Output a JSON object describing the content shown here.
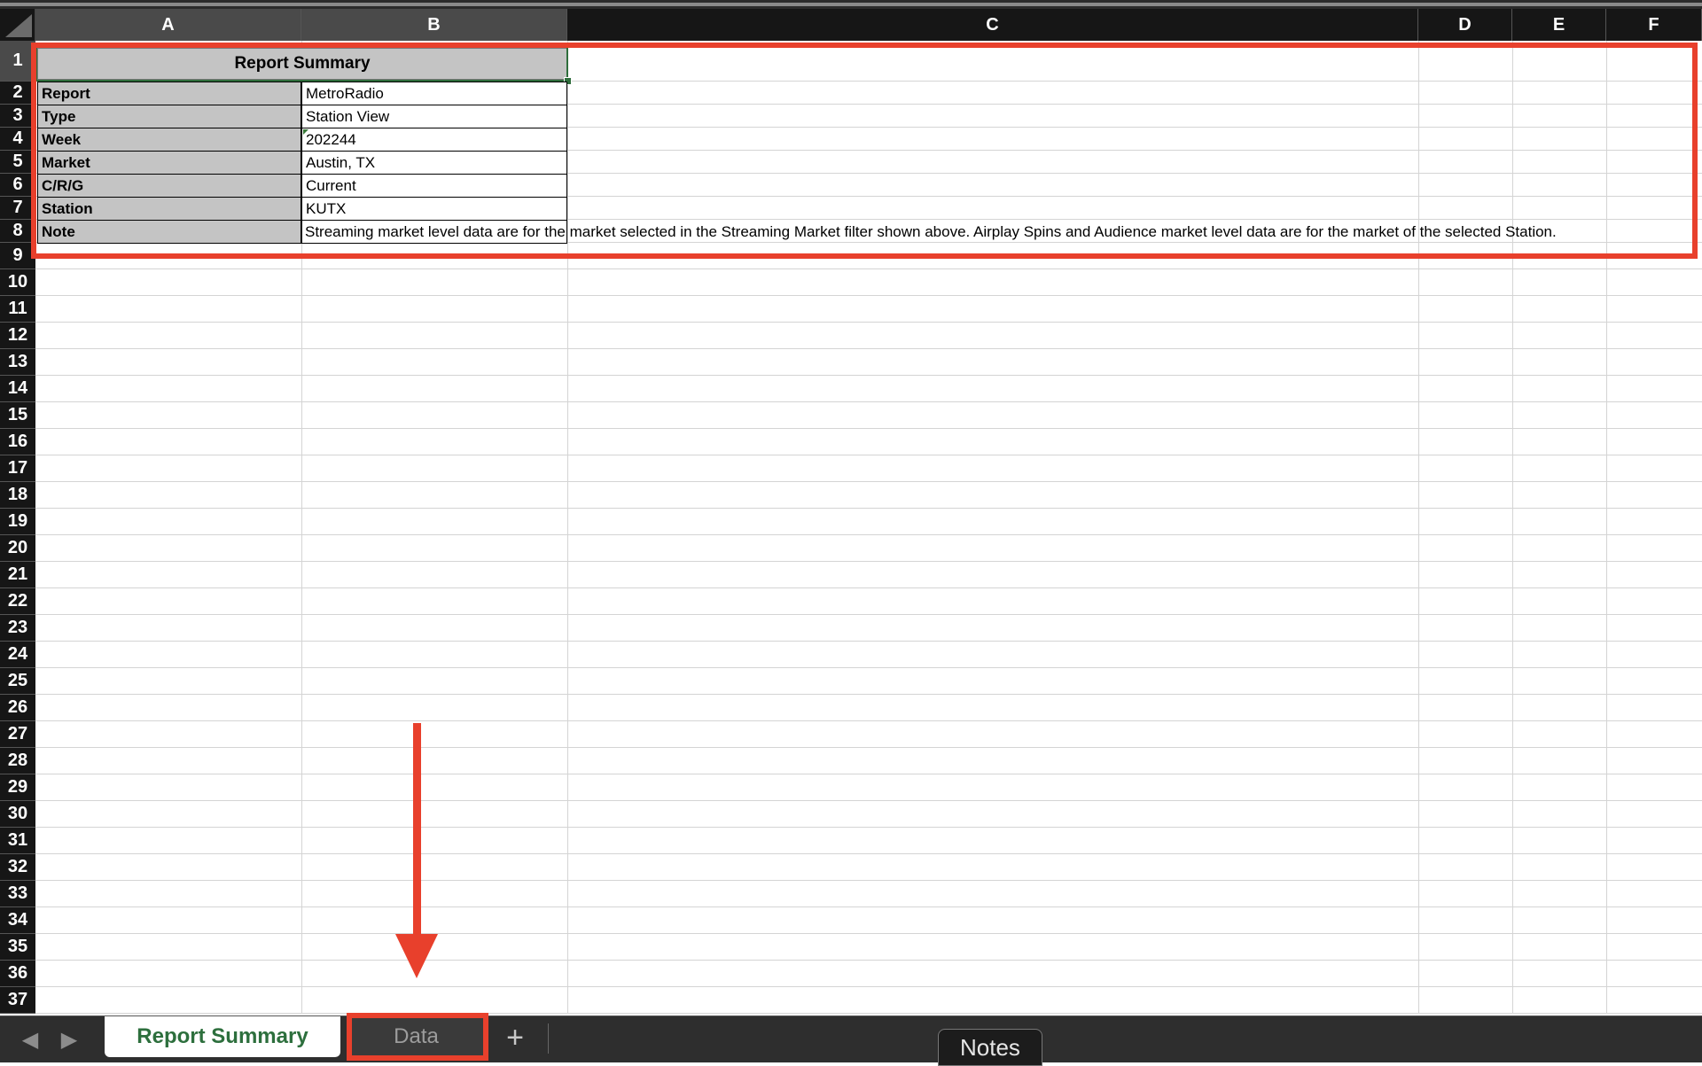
{
  "sheet": {
    "columns": [
      "A",
      "B",
      "C",
      "D",
      "E",
      "F"
    ],
    "row_numbers": [
      "1",
      "2",
      "3",
      "4",
      "5",
      "6",
      "7",
      "8",
      "9",
      "10",
      "11",
      "12",
      "13",
      "14",
      "15",
      "16",
      "17",
      "18",
      "19",
      "20",
      "21",
      "22",
      "23",
      "24",
      "25",
      "26",
      "27",
      "28",
      "29",
      "30",
      "31",
      "32",
      "33",
      "34",
      "35",
      "36",
      "37"
    ],
    "title": "Report Summary",
    "rows": [
      {
        "label": "Report",
        "value": "MetroRadio"
      },
      {
        "label": "Type",
        "value": "Station View"
      },
      {
        "label": "Week",
        "value": "202244"
      },
      {
        "label": "Market",
        "value": "Austin, TX"
      },
      {
        "label": "C/R/G",
        "value": "Current"
      },
      {
        "label": "Station",
        "value": "KUTX"
      },
      {
        "label": "Note",
        "value": "Streaming market level data are for the market selected in the Streaming Market filter shown above. Airplay Spins and Audience market level data are for the market of the selected Station."
      }
    ]
  },
  "tabs": {
    "prev_icon": "◀",
    "next_icon": "▶",
    "items": [
      {
        "label": "Report Summary",
        "active": true
      },
      {
        "label": "Data",
        "active": false
      }
    ],
    "add_label": "+",
    "notes_label": "Notes"
  },
  "annotations": {
    "color": "#e8402c",
    "highlights": [
      "report-summary-table",
      "data-tab"
    ],
    "arrow_target": "data-tab"
  }
}
